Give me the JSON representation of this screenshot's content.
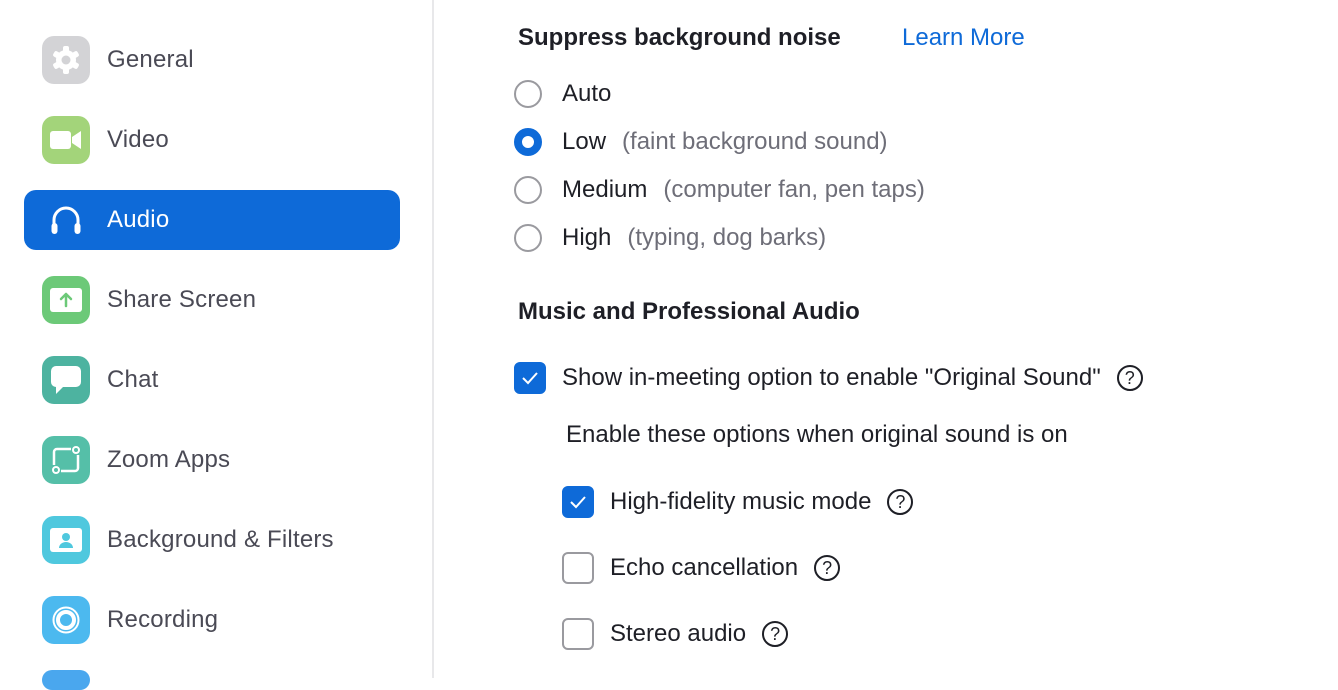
{
  "sidebar": {
    "items": [
      {
        "label": "General",
        "icon": "gear-icon",
        "color": "#d3d3d6",
        "active": false
      },
      {
        "label": "Video",
        "icon": "video-camera-icon",
        "color": "#a3d47a",
        "active": false
      },
      {
        "label": "Audio",
        "icon": "headphones-icon",
        "color": "#0e6ad8",
        "active": true
      },
      {
        "label": "Share Screen",
        "icon": "share-screen-icon",
        "color": "#6cc978",
        "active": false
      },
      {
        "label": "Chat",
        "icon": "chat-bubble-icon",
        "color": "#4db3a0",
        "active": false
      },
      {
        "label": "Zoom Apps",
        "icon": "zoom-apps-icon",
        "color": "#55bfa8",
        "active": false
      },
      {
        "label": "Background & Filters",
        "icon": "background-person-icon",
        "color": "#4fc8de",
        "active": false
      },
      {
        "label": "Recording",
        "icon": "record-icon",
        "color": "#4cb9ef",
        "active": false
      }
    ]
  },
  "main": {
    "noise": {
      "title": "Suppress background noise",
      "learn_more": "Learn More",
      "options": [
        {
          "label": "Auto",
          "desc": "",
          "selected": false
        },
        {
          "label": "Low",
          "desc": "(faint background sound)",
          "selected": true
        },
        {
          "label": "Medium",
          "desc": "(computer fan, pen taps)",
          "selected": false
        },
        {
          "label": "High",
          "desc": "(typing, dog barks)",
          "selected": false
        }
      ]
    },
    "music": {
      "title": "Music and Professional Audio",
      "original_sound": {
        "label": "Show in-meeting option to enable \"Original Sound\"",
        "checked": true
      },
      "caption": "Enable these options when original sound is on",
      "options": [
        {
          "label": "High-fidelity music mode",
          "checked": true
        },
        {
          "label": "Echo cancellation",
          "checked": false
        },
        {
          "label": "Stereo audio",
          "checked": false
        }
      ]
    },
    "help_glyph": "?"
  },
  "colors": {
    "accent": "#0e6ad8"
  }
}
